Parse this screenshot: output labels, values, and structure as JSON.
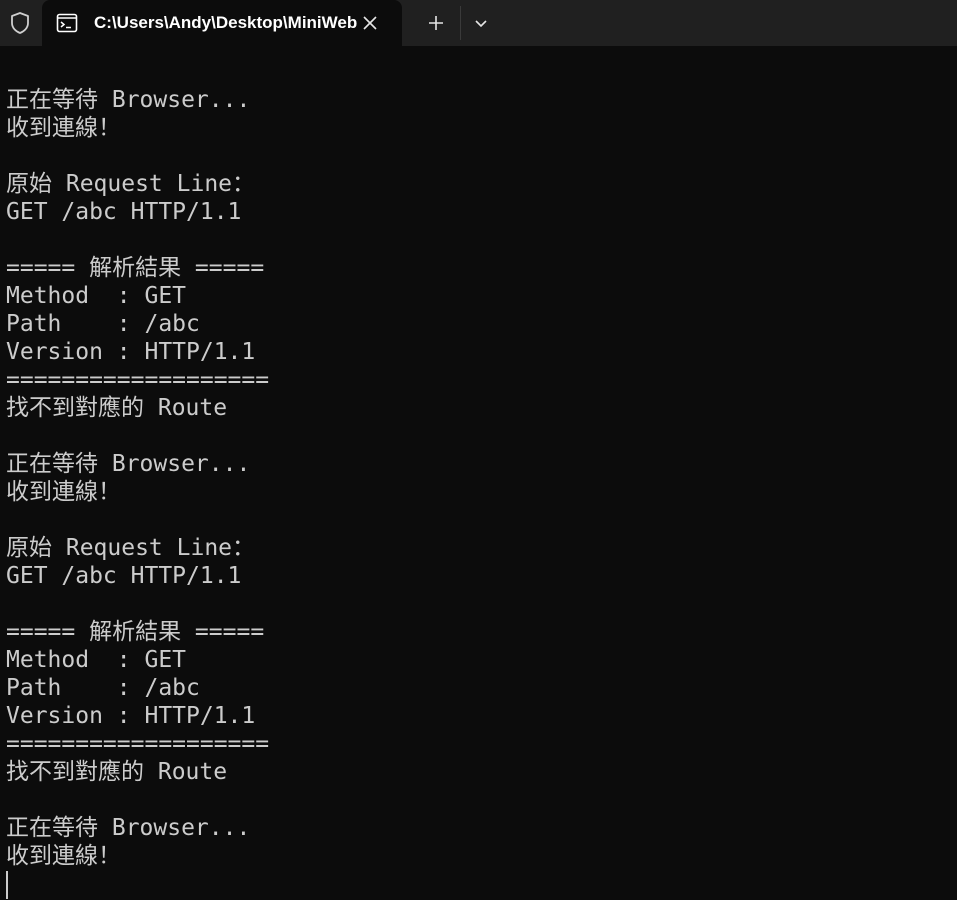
{
  "window": {
    "tab_title": "C:\\Users\\Andy\\Desktop\\MiniWeb",
    "icons": {
      "shield": "shield-icon",
      "tab": "terminal-icon",
      "close": "close-icon",
      "new_tab": "plus-icon",
      "dropdown": "chevron-down-icon"
    }
  },
  "colors": {
    "background": "#0c0c0c",
    "titlebar": "#202020",
    "text": "#cccccc"
  },
  "console": {
    "lines": [
      "正在等待 Browser...",
      "收到連線！",
      "",
      "原始 Request Line：",
      "GET /abc HTTP/1.1",
      "",
      "===== 解析結果 =====",
      "Method  : GET",
      "Path    : /abc",
      "Version : HTTP/1.1",
      "===================",
      "找不到對應的 Route",
      "",
      "正在等待 Browser...",
      "收到連線！",
      "",
      "原始 Request Line：",
      "GET /abc HTTP/1.1",
      "",
      "===== 解析結果 =====",
      "Method  : GET",
      "Path    : /abc",
      "Version : HTTP/1.1",
      "===================",
      "找不到對應的 Route",
      "",
      "正在等待 Browser...",
      "收到連線！"
    ]
  }
}
